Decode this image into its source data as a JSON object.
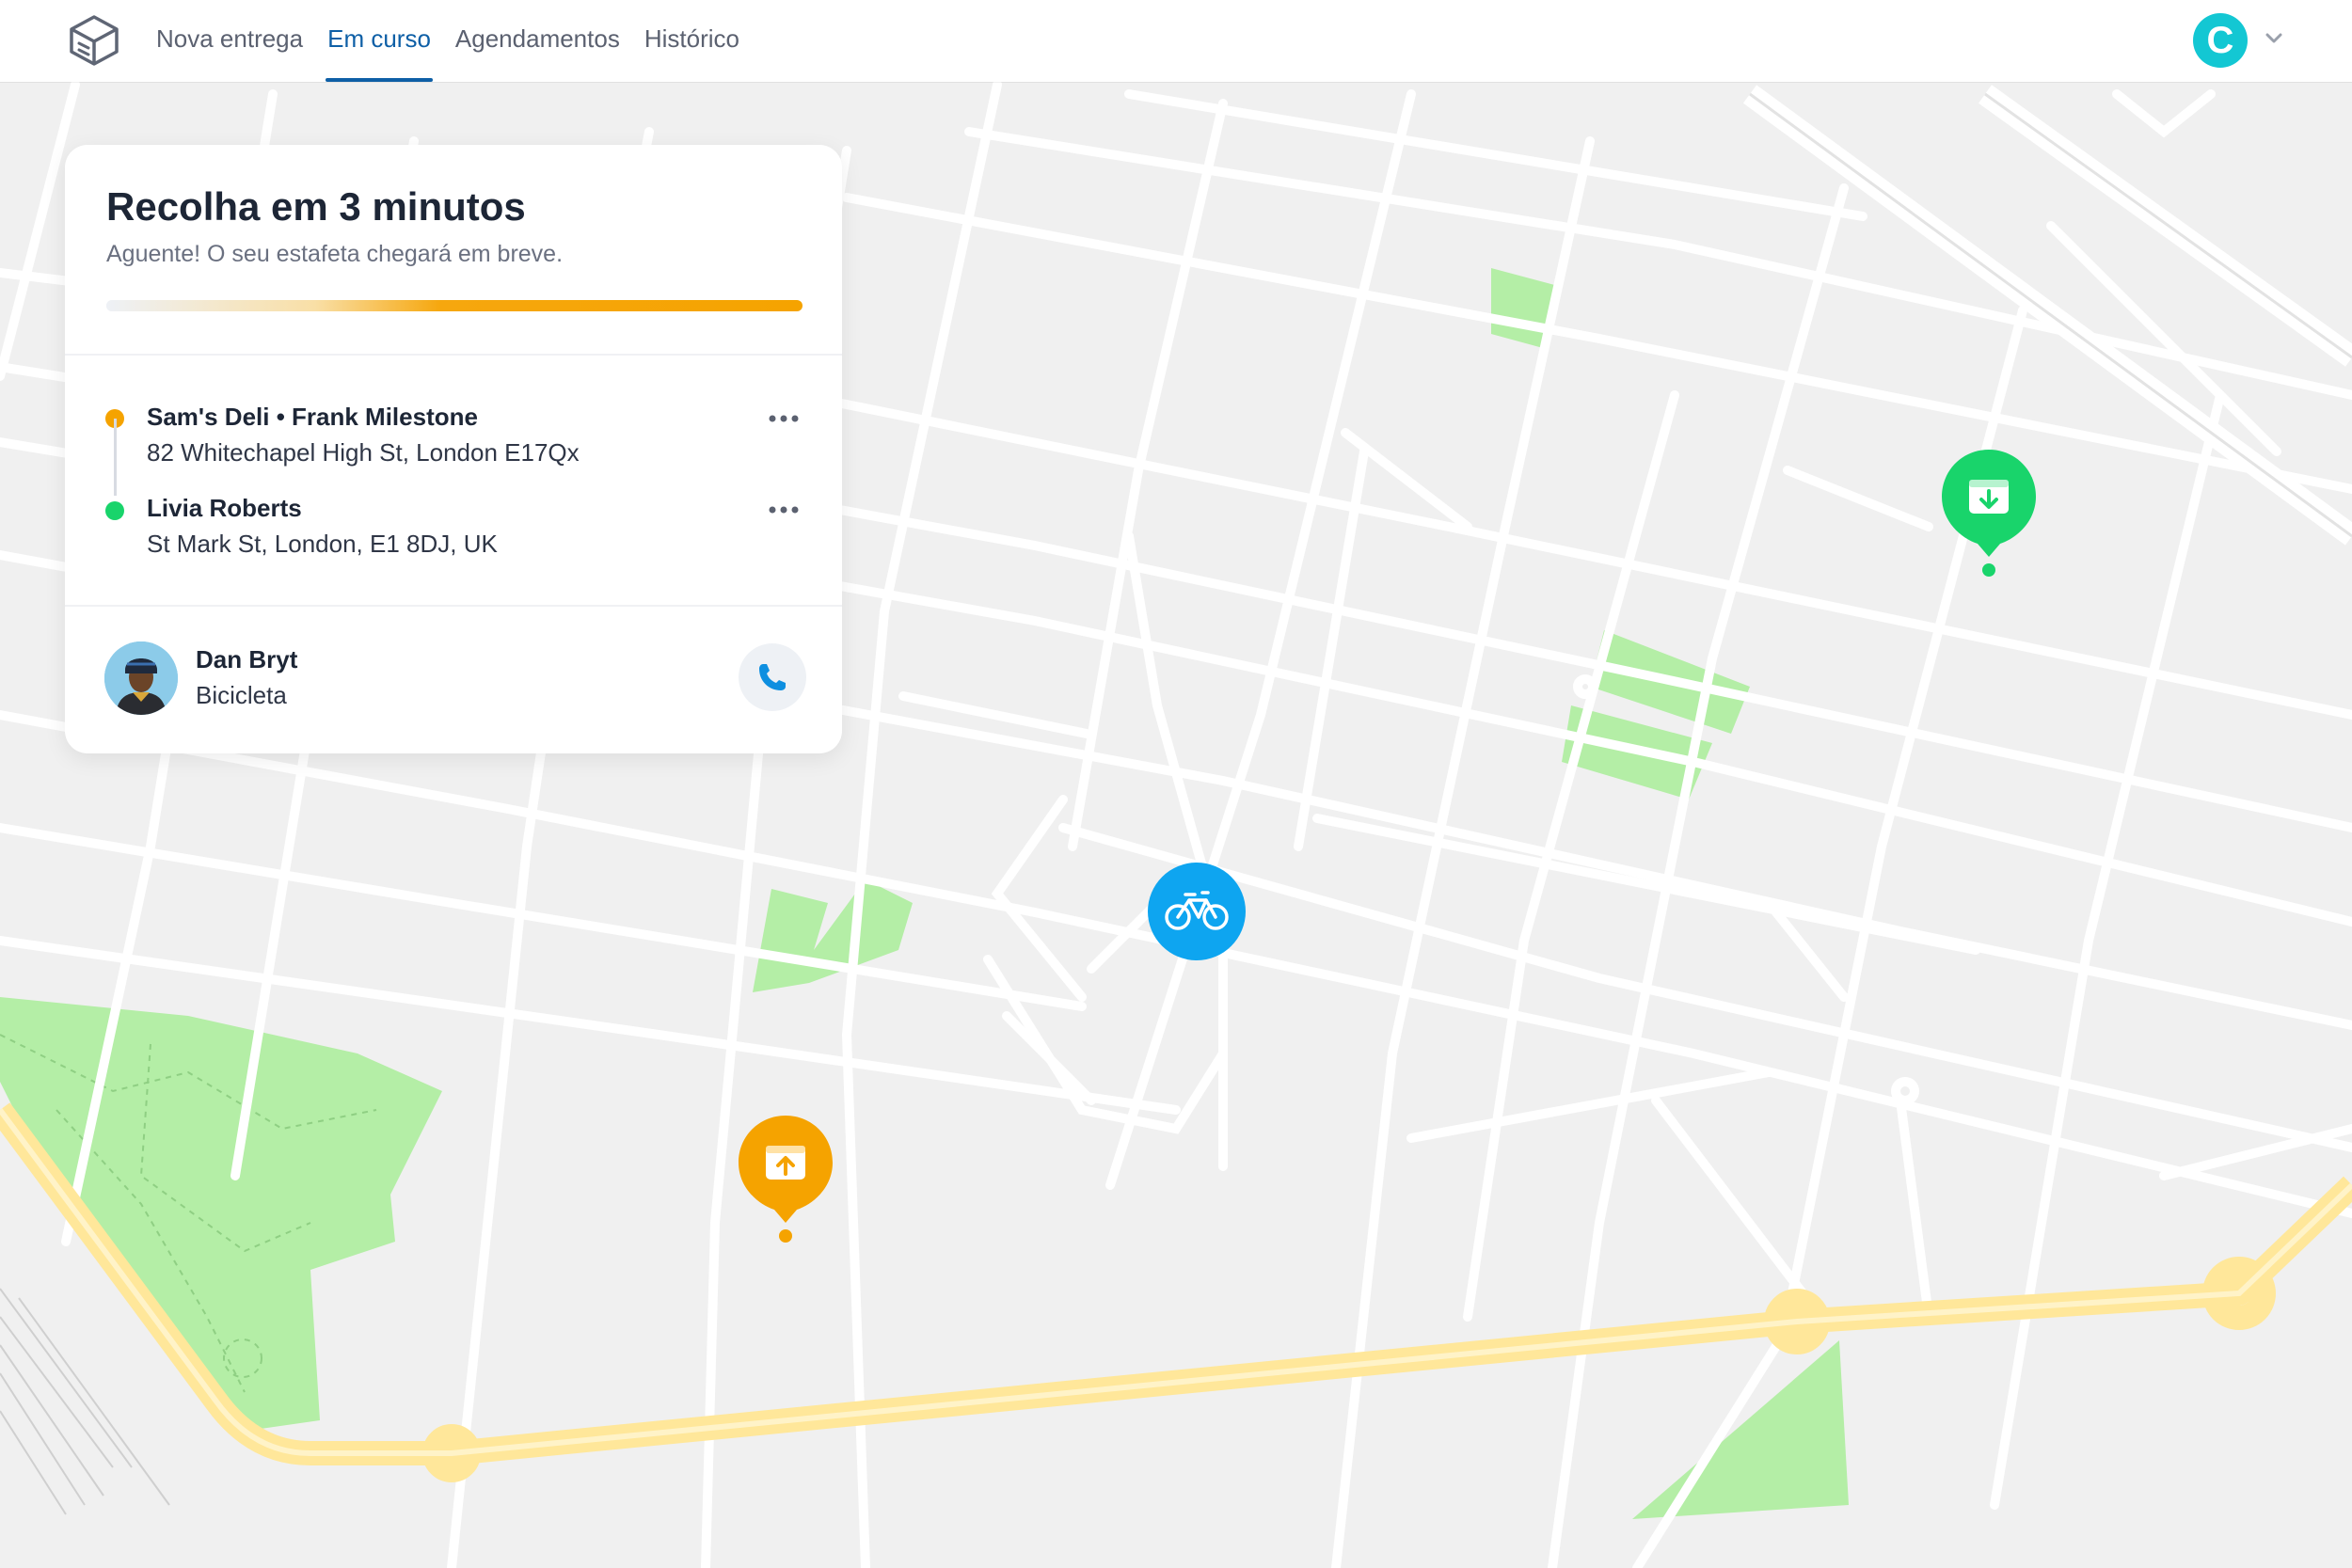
{
  "nav": {
    "items": [
      {
        "label": "Nova entrega"
      },
      {
        "label": "Em curso",
        "active": true
      },
      {
        "label": "Agendamentos"
      },
      {
        "label": "Histórico"
      }
    ]
  },
  "user": {
    "initial": "C",
    "color": "#13c7d3"
  },
  "status": {
    "title": "Recolha em 3 minutos",
    "subtitle": "Aguente! O seu estafeta chegará em breve.",
    "progress": 1.0
  },
  "route": {
    "pickup": {
      "name": "Sam's Deli • Frank Milestone",
      "address": "82 Whitechapel High St, London E17Qx",
      "color": "#f5a300"
    },
    "dropoff": {
      "name": "Livia Roberts",
      "address": "St Mark St, London, E1 8DJ, UK",
      "color": "#19d46b"
    }
  },
  "courier": {
    "name": "Dan Bryt",
    "vehicle": "Bicicleta"
  },
  "icons": {
    "logo": "box-logo-icon",
    "more": "more-dots-icon",
    "call": "phone-icon",
    "bike": "bicycle-icon",
    "pickup_marker": "box-upload-icon",
    "dropoff_marker": "box-download-icon",
    "chevron": "chevron-down-icon"
  },
  "colors": {
    "accent": "#0e5fa6",
    "pickup": "#f5a300",
    "dropoff": "#19d46b",
    "courier": "#0ea5f0",
    "park": "#b4eea6",
    "railway": "#ffe79a"
  }
}
